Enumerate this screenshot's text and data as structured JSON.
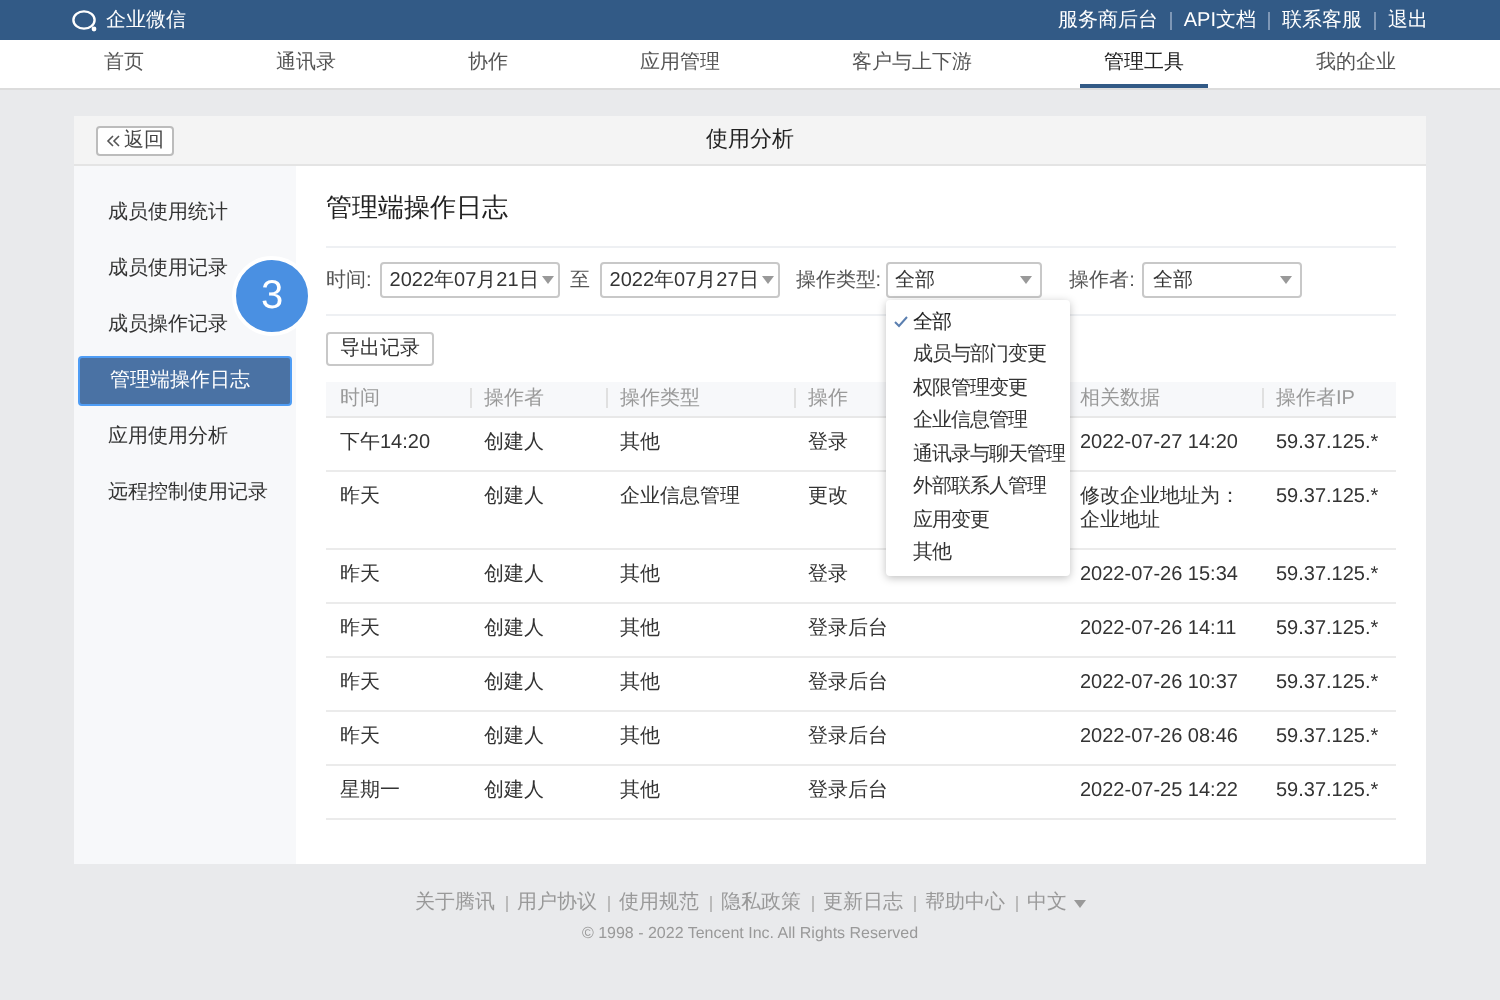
{
  "app": {
    "name": "企业微信"
  },
  "top_links": [
    "服务商后台",
    "API文档",
    "联系客服",
    "退出"
  ],
  "nav": [
    {
      "label": "首页",
      "selected": false
    },
    {
      "label": "通讯录",
      "selected": false
    },
    {
      "label": "协作",
      "selected": false
    },
    {
      "label": "应用管理",
      "selected": false
    },
    {
      "label": "客户与上下游",
      "selected": false
    },
    {
      "label": "管理工具",
      "selected": true
    },
    {
      "label": "我的企业",
      "selected": false
    }
  ],
  "page": {
    "back": "返回",
    "title": "使用分析"
  },
  "sidebar": [
    {
      "label": "成员使用统计",
      "selected": false
    },
    {
      "label": "成员使用记录",
      "selected": false
    },
    {
      "label": "成员操作记录",
      "selected": false
    },
    {
      "label": "管理端操作日志",
      "selected": true
    },
    {
      "label": "应用使用分析",
      "selected": false
    },
    {
      "label": "远程控制使用记录",
      "selected": false
    }
  ],
  "step_badge": "3",
  "content_title": "管理端操作日志",
  "filters": {
    "time_label": "时间:",
    "start": "2022年07月21日",
    "to": "至",
    "end": "2022年07月27日",
    "type_label": "操作类型:",
    "type_value": "全部",
    "operator_label": "操作者:",
    "operator_value": "全部"
  },
  "export_button": "导出记录",
  "dropdown": [
    {
      "label": "全部",
      "selected": true
    },
    {
      "label": "成员与部门变更",
      "selected": false
    },
    {
      "label": "权限管理变更",
      "selected": false
    },
    {
      "label": "企业信息管理",
      "selected": false
    },
    {
      "label": "通讯录与聊天管理",
      "selected": false
    },
    {
      "label": "外部联系人管理",
      "selected": false
    },
    {
      "label": "应用变更",
      "selected": false
    },
    {
      "label": "其他",
      "selected": false
    }
  ],
  "table": {
    "columns": [
      "时间",
      "操作者",
      "操作类型",
      "操作",
      "相关数据",
      "操作者IP"
    ],
    "rows": [
      [
        "下午14:20",
        "创建人",
        "其他",
        "登录",
        "2022-07-27 14:20",
        "59.37.125.*"
      ],
      [
        "昨天",
        "创建人",
        "企业信息管理",
        "更改",
        "修改企业地址为：企业地址",
        "59.37.125.*"
      ],
      [
        "昨天",
        "创建人",
        "其他",
        "登录",
        "2022-07-26 15:34",
        "59.37.125.*"
      ],
      [
        "昨天",
        "创建人",
        "其他",
        "登录后台",
        "2022-07-26 14:11",
        "59.37.125.*"
      ],
      [
        "昨天",
        "创建人",
        "其他",
        "登录后台",
        "2022-07-26 10:37",
        "59.37.125.*"
      ],
      [
        "昨天",
        "创建人",
        "其他",
        "登录后台",
        "2022-07-26 08:46",
        "59.37.125.*"
      ],
      [
        "星期一",
        "创建人",
        "其他",
        "登录后台",
        "2022-07-25 14:22",
        "59.37.125.*"
      ]
    ]
  },
  "footer": {
    "links": [
      "关于腾讯",
      "用户协议",
      "使用规范",
      "隐私政策",
      "更新日志",
      "帮助中心"
    ],
    "language": "中文",
    "copyright": "© 1998 - 2022 Tencent Inc. All Rights Reserved"
  }
}
